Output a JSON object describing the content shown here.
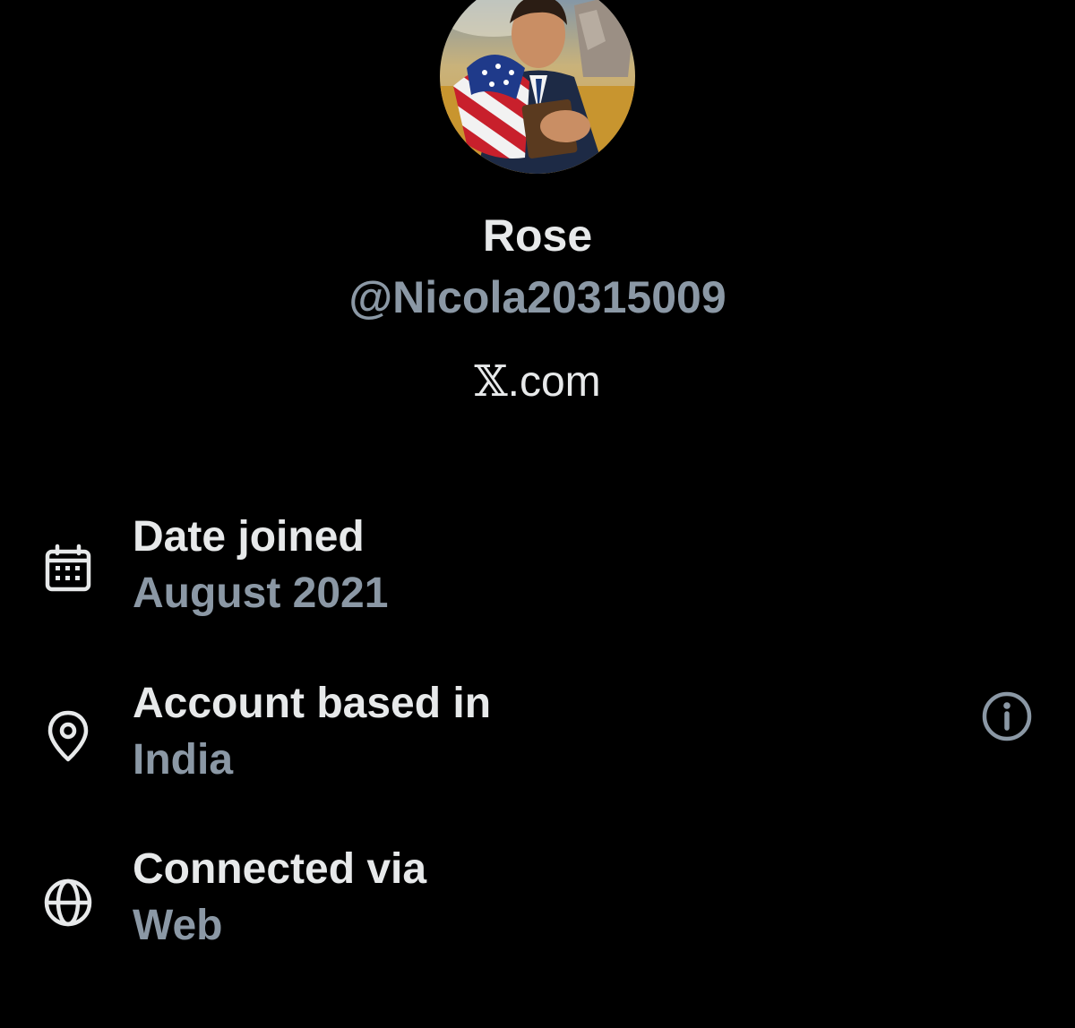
{
  "profile": {
    "display_name": "Rose",
    "handle": "@Nicola20315009",
    "platform_mark": "𝕏",
    "platform_suffix": ".com"
  },
  "details": [
    {
      "icon": "calendar-icon",
      "title": "Date joined",
      "value": "August 2021"
    },
    {
      "icon": "location-pin-icon",
      "title": "Account based in",
      "value": "India",
      "action_icon": "info-icon"
    },
    {
      "icon": "globe-icon",
      "title": "Connected via",
      "value": "Web"
    }
  ],
  "colors": {
    "background": "#000000",
    "primary_text": "#e7e9ea",
    "secondary_text": "#8b98a5"
  }
}
